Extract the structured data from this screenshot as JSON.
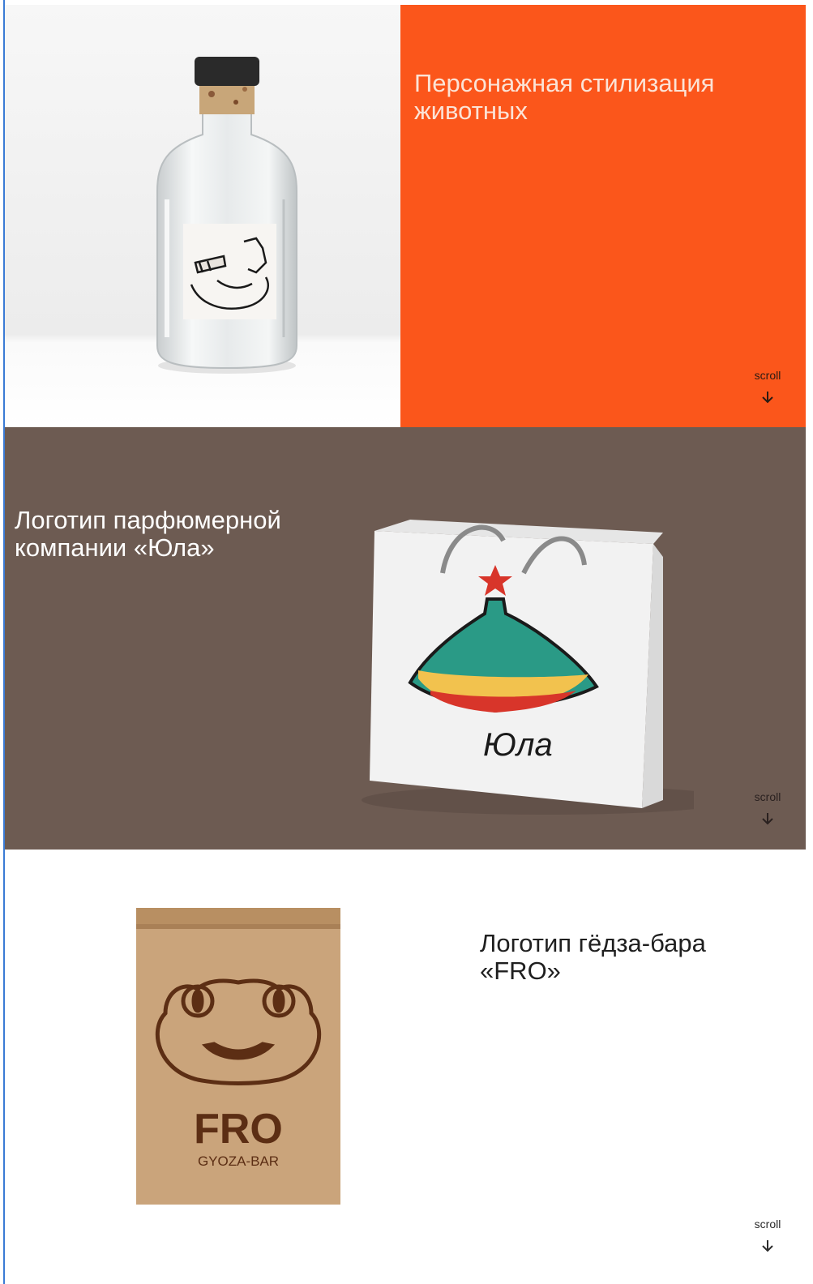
{
  "colors": {
    "accent_orange": "#fb561b",
    "brown_bg": "#6d5b52",
    "white_bg": "#ffffff"
  },
  "sections": [
    {
      "title": "Персонажная стилизация животных",
      "scroll_label": "scroll",
      "image": "glass-bottle-with-fox-character-label"
    },
    {
      "title": "Логотип парфюмерной компании «Юла»",
      "scroll_label": "scroll",
      "image": "gift-bag-with-perfume-bottle-logo",
      "logo_text": "Юла"
    },
    {
      "title": "Логотип гёдза-бара «FRO»",
      "scroll_label": "scroll",
      "image": "kraft-paper-bag-with-frog-logo",
      "logo_text": "FRO",
      "logo_subtext": "GYOZA-BAR"
    }
  ]
}
